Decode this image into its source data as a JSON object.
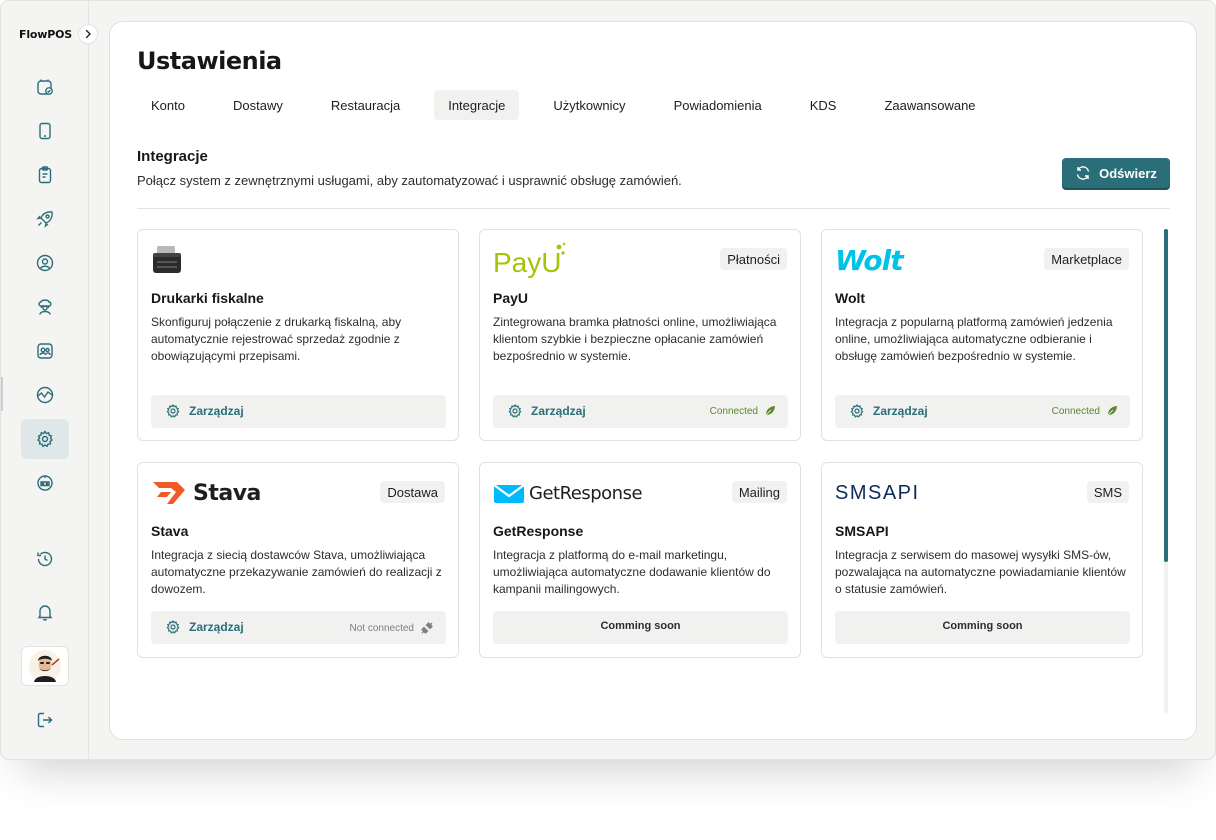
{
  "app": {
    "logo": "FlowPOS"
  },
  "sidebar": {
    "items": [
      {
        "icon": "orders-icon",
        "active": false
      },
      {
        "icon": "tablet-icon",
        "active": false
      },
      {
        "icon": "clipboard-icon",
        "active": false
      },
      {
        "icon": "rocket-icon",
        "active": false
      },
      {
        "icon": "user-circle-icon",
        "active": false
      },
      {
        "icon": "chef-icon",
        "active": false
      },
      {
        "icon": "contacts-icon",
        "active": false
      },
      {
        "icon": "analytics-icon",
        "active": false
      },
      {
        "icon": "gear-icon",
        "active": true
      },
      {
        "icon": "robot-icon",
        "active": false
      },
      {
        "icon": "history-icon",
        "active": false
      },
      {
        "icon": "bell-icon",
        "active": false
      },
      {
        "icon": "logout-icon",
        "active": false
      }
    ]
  },
  "page": {
    "title": "Ustawienia",
    "tabs": [
      "Konto",
      "Dostawy",
      "Restauracja",
      "Integracje",
      "Użytkownicy",
      "Powiadomienia",
      "KDS",
      "Zaawansowane"
    ],
    "active_tab": "Integracje"
  },
  "section": {
    "title": "Integracje",
    "description": "Połącz system z zewnętrznymi usługami, aby zautomatyzować i usprawnić obsługę zamówień.",
    "refresh_label": "Odświerz"
  },
  "cards": [
    {
      "logo_text": "",
      "badge": "",
      "title": "Drukarki fiskalne",
      "description": "Skonfiguruj połączenie z drukarką fiskalną, aby automatycznie rejestrować sprzedaż zgodnie z obowiązującymi przepisami.",
      "manage_label": "Zarządzaj",
      "status": ""
    },
    {
      "logo_text": "PayU",
      "badge": "Płatności",
      "title": "PayU",
      "description": "Zintegrowana bramka płatności online, umożliwiająca klientom szybkie i bezpieczne opłacanie zamówień bezpośrednio w systemie.",
      "manage_label": "Zarządzaj",
      "status": "Connected"
    },
    {
      "logo_text": "Wolt",
      "badge": "Marketplace",
      "title": "Wolt",
      "description": "Integracja z popularną platformą zamówień jedzenia online, umożliwiająca automatyczne odbieranie i obsługę zamówień bezpośrednio w systemie.",
      "manage_label": "Zarządzaj",
      "status": "Connected"
    },
    {
      "logo_text": "Stava",
      "badge": "Dostawa",
      "title": "Stava",
      "description": "Integracja z siecią dostawców Stava, umożliwiająca automatyczne przekazywanie zamówień do realizacji z dowozem.",
      "manage_label": "Zarządzaj",
      "status": "Not connected"
    },
    {
      "logo_text": "GetResponse",
      "badge": "Mailing",
      "title": "GetResponse",
      "description": "Integracja z platformą do e-mail marketingu, umożliwiająca automatyczne dodawanie klientów do kampanii mailingowych.",
      "coming_soon": "Comming soon"
    },
    {
      "logo_text": "SMSAPI",
      "badge": "SMS",
      "title": "SMSAPI",
      "description": "Integracja z serwisem do masowej wysyłki SMS-ów, pozwalająca na automatyczne powiadamianie klientów o statusie zamówień.",
      "coming_soon": "Comming soon"
    }
  ],
  "colors": {
    "accent": "#2a6e7a",
    "connected": "#5a8a2d",
    "payu_green": "#a6c307",
    "wolt_blue": "#00c2e8",
    "stava_orange": "#f05a28",
    "getresponse_blue": "#00baff",
    "smsapi_navy": "#0e2a5c"
  }
}
